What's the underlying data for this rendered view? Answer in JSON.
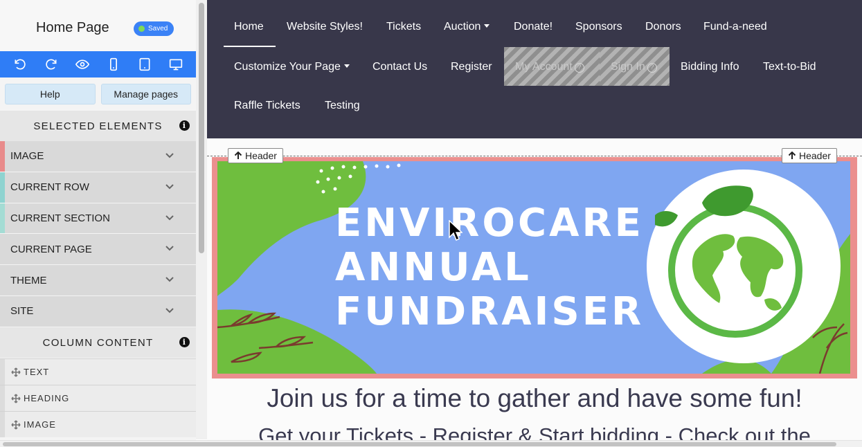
{
  "sidebar": {
    "title": "Home Page",
    "saved_badge": "Saved",
    "toolbar": {
      "buttons": [
        "undo-icon",
        "redo-icon",
        "preview-eye-icon",
        "mobile-view-icon",
        "tablet-view-icon",
        "desktop-view-icon"
      ]
    },
    "help_button": "Help",
    "manage_pages_button": "Manage pages",
    "selected_elements_heading": "SELECTED ELEMENTS",
    "accordion": [
      {
        "label": "IMAGE",
        "stripe": "#e88b8b"
      },
      {
        "label": "CURRENT ROW",
        "stripe": "#8fd3d0"
      },
      {
        "label": "CURRENT SECTION",
        "stripe": "#a4dcd4"
      },
      {
        "label": "CURRENT PAGE",
        "stripe": "#d9d9d9"
      },
      {
        "label": "THEME",
        "stripe": "#d9d9d9"
      },
      {
        "label": "SITE",
        "stripe": "#d9d9d9"
      }
    ],
    "column_content_heading": "COLUMN CONTENT",
    "column_content_items": [
      "TEXT",
      "HEADING",
      "IMAGE"
    ]
  },
  "nav": {
    "row1": [
      "Home",
      "Website Styles!",
      "Tickets",
      "Auction",
      "Donate!",
      "Sponsors",
      "Donors",
      "Fund-a-need"
    ],
    "row2": [
      "Customize Your Page",
      "Contact Us",
      "Register",
      "My Account",
      "Sign In",
      "Bidding Info",
      "Text-to-Bid"
    ],
    "row3": [
      "Raffle Tickets",
      "Testing"
    ],
    "active": "Home"
  },
  "header_tags": [
    "Header",
    "Header"
  ],
  "banner": {
    "line1": "ENVIROCARE",
    "line2": "ANNUAL",
    "line3": "FUNDRAISER"
  },
  "content": {
    "headline": "Join us for a time to gather and have some fun!",
    "subline": "Get your Tickets - Register & Start bidding - Check out the"
  },
  "colors": {
    "toolbar_blue": "#2f7df6",
    "nav_bg": "#38374a",
    "selected_outline": "#eb8f8e",
    "banner_blue": "#7fa6f1",
    "leaf_green": "#6fbe3e"
  }
}
